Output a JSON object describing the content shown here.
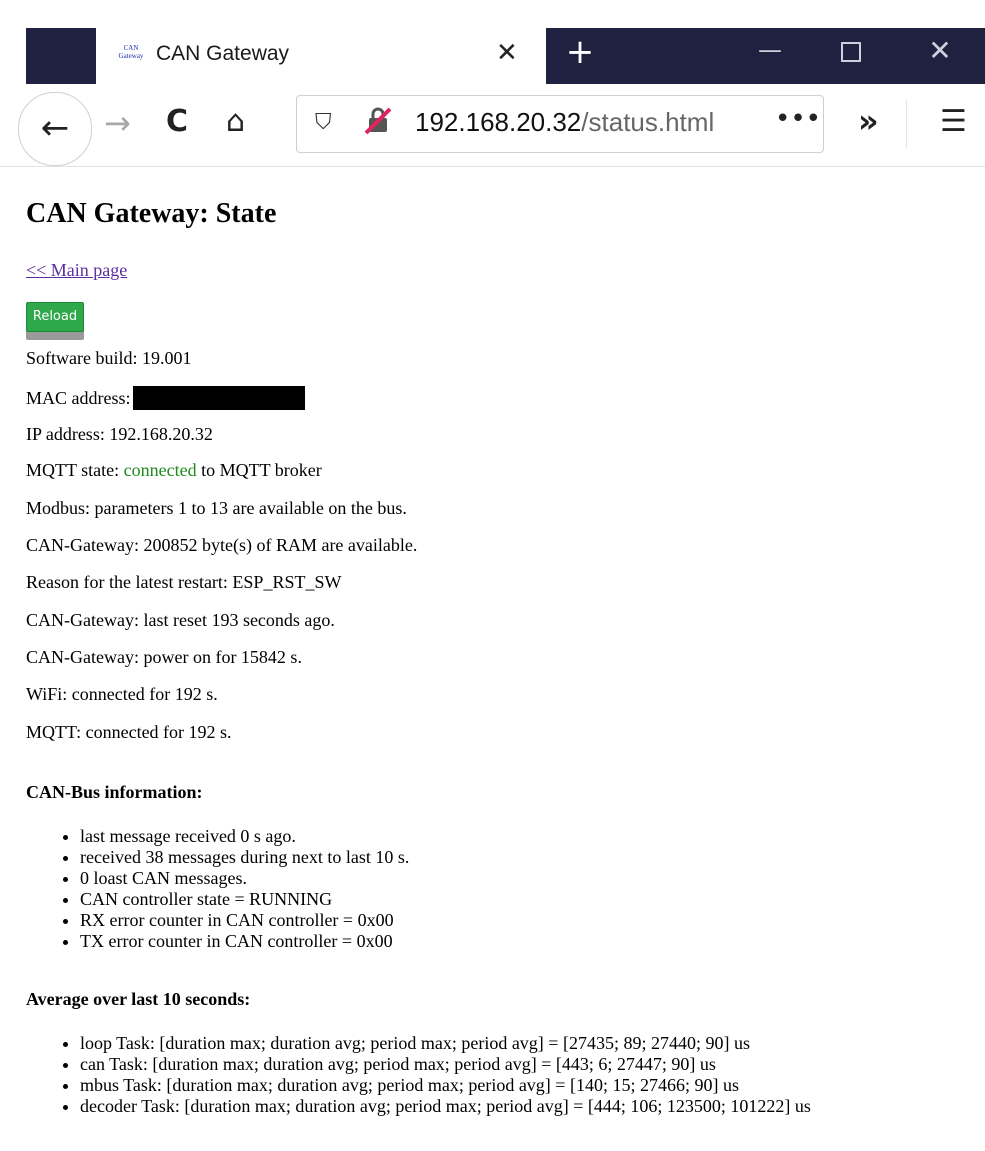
{
  "browser": {
    "tab_title": "CAN Gateway",
    "favicon_text": "CAN\nGateway",
    "url_host": "192.168.20.32",
    "url_path": "/status.html",
    "tab_close_glyph": "✕",
    "new_tab_glyph": "+",
    "min_glyph": "—",
    "close_glyph": "✕",
    "back_glyph": "←",
    "forward_glyph": "→",
    "reload_glyph": "C",
    "home_glyph": "⌂",
    "shield_glyph": "⛉",
    "more_glyph": "•••",
    "overflow_glyph": "»",
    "menu_glyph": "☰"
  },
  "page": {
    "title": "CAN Gateway: State",
    "main_link": "<< Main page",
    "reload_label": "Reload",
    "software_build": "Software build: 19.001",
    "mac_label": "MAC address:",
    "ip": "IP address: 192.168.20.32",
    "mqtt_prefix": "MQTT state: ",
    "mqtt_state": "connected",
    "mqtt_suffix": " to MQTT broker",
    "modbus": "Modbus: parameters 1 to 13 are available on the bus.",
    "ram": "CAN-Gateway: 200852 byte(s) of RAM are available.",
    "restart_reason": "Reason for the latest restart: ESP_RST_SW",
    "last_reset": "CAN-Gateway: last reset 193 seconds ago.",
    "power_on": "CAN-Gateway: power on for 15842 s.",
    "wifi": "WiFi: connected for 192 s.",
    "mqtt_connected": "MQTT: connected for 192 s."
  },
  "canbus": {
    "heading": "CAN-Bus information:",
    "items": [
      "last message received 0 s ago.",
      "received 38 messages during next to last 10 s.",
      "0 loast CAN messages.",
      "CAN controller state = RUNNING",
      "RX error counter in CAN controller = 0x00",
      "TX error counter in CAN controller = 0x00"
    ]
  },
  "average": {
    "heading": "Average over last 10 seconds:",
    "items": [
      "loop Task: [duration max; duration avg; period max; period avg] = [27435; 89; 27440; 90] us",
      "can Task: [duration max; duration avg; period max; period avg] = [443; 6; 27447; 90] us",
      "mbus Task: [duration max; duration avg; period max; period avg] = [140; 15; 27466; 90] us",
      "decoder Task: [duration max; duration avg; period max; period avg] = [444; 106; 123500; 101222] us"
    ]
  },
  "colors": {
    "tabbar": "#1f2140",
    "connected": "#1e8a1e",
    "reload_button": "#2ea84a",
    "link": "#5c2e9e"
  }
}
